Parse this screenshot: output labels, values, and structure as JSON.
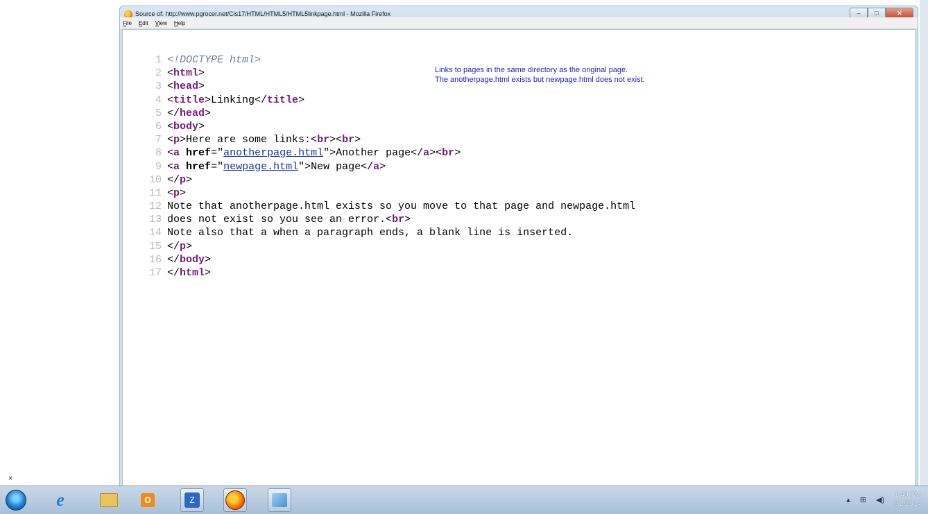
{
  "window": {
    "title": "Source of: http://www.pgrocer.net/Cis17/HTML/HTML5/HTML5linkpage.html - Mozilla Firefox",
    "buttons": {
      "minimize": "–",
      "maximize": "□",
      "close": "✕"
    }
  },
  "menu": [
    "File",
    "Edit",
    "View",
    "Help"
  ],
  "note": {
    "line1": "Links to pages in the same directory as the original page.",
    "line2": "The anotherpage.html exists but newpage.html does not exist."
  },
  "code": {
    "line_numbers": [
      "1",
      "2",
      "3",
      "4",
      "5",
      "6",
      "7",
      "8",
      "9",
      "10",
      "11",
      "12",
      "13",
      "14",
      "15",
      "16",
      "17"
    ],
    "l1_doctype": "<!DOCTYPE html>",
    "l2_open": "<",
    "l2_tag": "html",
    "l2_close": ">",
    "l3_open": "<",
    "l3_tag": "head",
    "l3_close": ">",
    "l4_a": "<",
    "l4_tag1": "title",
    "l4_b": ">Linking</",
    "l4_tag2": "title",
    "l4_c": ">",
    "l5_a": "</",
    "l5_tag": "head",
    "l5_b": ">",
    "l6_a": "<",
    "l6_tag": "body",
    "l6_b": ">",
    "l7_a": "<",
    "l7_tag1": "p",
    "l7_b": ">Here are some links:<",
    "l7_tag2": "br",
    "l7_c": "><",
    "l7_tag3": "br",
    "l7_d": ">",
    "l8_a": "<",
    "l8_tag1": "a",
    "l8_attr": "href",
    "l8_b": "=\"",
    "l8_link": "anotherpage.html",
    "l8_c": "\">Another page</",
    "l8_tag2": "a",
    "l8_d": "><",
    "l8_tag3": "br",
    "l8_e": ">",
    "l9_a": "<",
    "l9_tag1": "a",
    "l9_attr": "href",
    "l9_b": "=\"",
    "l9_link": "newpage.html",
    "l9_c": "\">New page</",
    "l9_tag2": "a",
    "l9_d": ">",
    "l10_a": "</",
    "l10_tag": "p",
    "l10_b": ">",
    "l11_a": "<",
    "l11_tag": "p",
    "l11_b": ">",
    "l12_text": "Note that anotherpage.html exists so you move to that page and newpage.html",
    "l13_text": "does not exist so you see an error.<",
    "l13_tag": "br",
    "l13_b": ">",
    "l14_text": "Note also that a when a paragraph ends, a blank line is inserted.",
    "l15_a": "</",
    "l15_tag": "p",
    "l15_b": ">",
    "l16_a": "</",
    "l16_tag": "body",
    "l16_b": ">",
    "l17_a": "</",
    "l17_tag": "html",
    "l17_b": ">"
  },
  "taskbar": {
    "close_mark": "×",
    "media_label": "O",
    "notes_label": "Z",
    "clock_time": "1:40 PM",
    "clock_date": "9/2/2014",
    "tray_arrow": "▴",
    "tray_network": "⊞",
    "tray_volume": "◀)"
  }
}
